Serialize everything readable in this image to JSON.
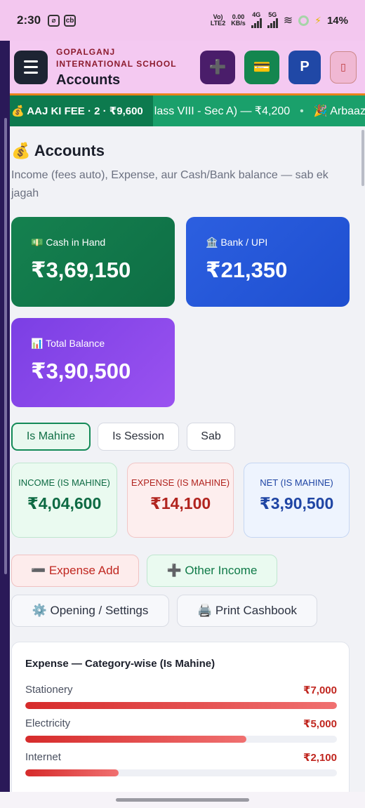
{
  "status": {
    "time": "2:30",
    "net_top": "0.00",
    "net_bottom": "KB/s",
    "volte": "Vo)",
    "lte": "LTE2",
    "g4": "4G",
    "g5": "5G",
    "battery": "14%"
  },
  "header": {
    "school": "GOPALGANJ INTERNATIONAL SCHOOL",
    "title": "Accounts",
    "btn_add": "➕",
    "btn_card": "💳",
    "btn_profile": "P",
    "btn_extra": "▯"
  },
  "ticker": {
    "label": "💰 AAJ KI FEE · 2 · ₹9,600",
    "item1": "lass VIII - Sec A) — ₹4,200",
    "item2": "🎉 Arbaaz"
  },
  "page": {
    "heading": "💰 Accounts",
    "subtitle": "Income (fees auto), Expense, aur Cash/Bank balance — sab ek jagah"
  },
  "cards": {
    "cash": {
      "label": "💵 Cash in Hand",
      "value": "₹3,69,150"
    },
    "bank": {
      "label": "🏦 Bank / UPI",
      "value": "₹21,350"
    },
    "total": {
      "label": "📊 Total Balance",
      "value": "₹3,90,500"
    }
  },
  "tabs": [
    "Is Mahine",
    "Is Session",
    "Sab"
  ],
  "stats": {
    "income": {
      "label": "INCOME (IS MAHINE)",
      "value": "₹4,04,600"
    },
    "expense": {
      "label": "EXPENSE (IS MAHINE)",
      "value": "₹14,100"
    },
    "net": {
      "label": "NET (IS MAHINE)",
      "value": "₹3,90,500"
    }
  },
  "actions": {
    "expense_add": "➖ Expense Add",
    "other_income": "➕ Other Income",
    "settings": "⚙️ Opening / Settings",
    "print": "🖨️ Print Cashbook"
  },
  "expense_panel": {
    "title": "Expense — Category-wise (Is Mahine)",
    "rows": [
      {
        "name": "Stationery",
        "amount": "₹7,000",
        "share": 1.0
      },
      {
        "name": "Electricity",
        "amount": "₹5,000",
        "share": 0.71
      },
      {
        "name": "Internet",
        "amount": "₹2,100",
        "share": 0.3
      }
    ]
  }
}
